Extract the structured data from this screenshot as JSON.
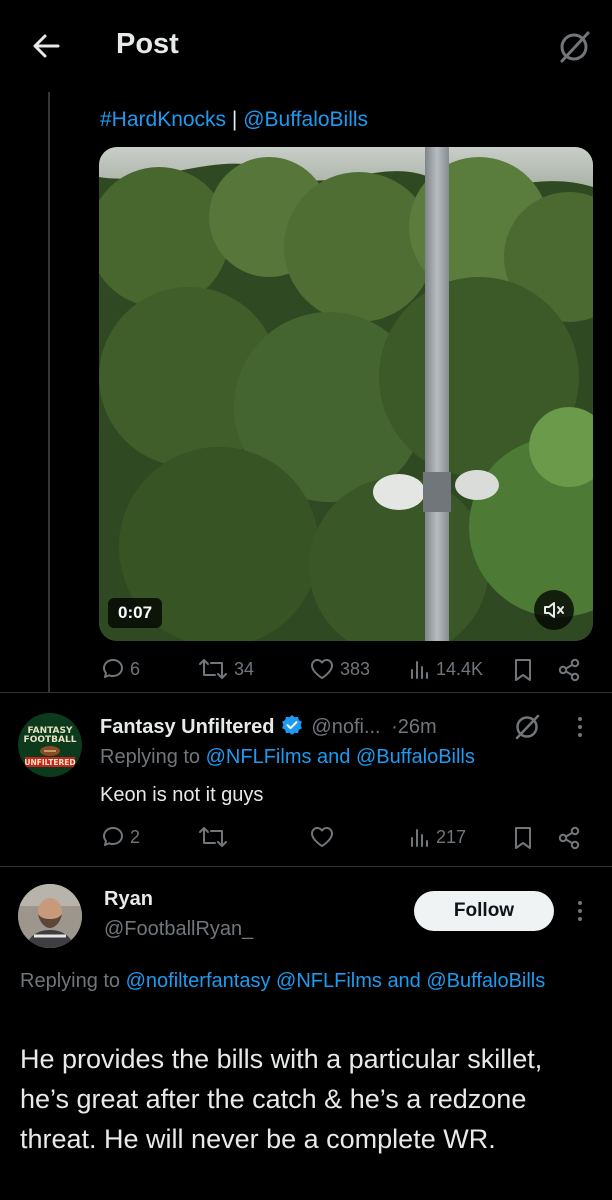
{
  "header": {
    "title": "Post"
  },
  "post": {
    "hashtag": "#HardKnocks",
    "separator": "|",
    "mention": "@BuffaloBills",
    "video_duration": "0:07",
    "stats": {
      "replies": "6",
      "reposts": "34",
      "likes": "383",
      "views": "14.4K"
    }
  },
  "reply1": {
    "avatar_lines": [
      "FANTASY",
      "FOOTBALL",
      "UNFILTERED"
    ],
    "name": "Fantasy Unfiltered",
    "handle": "@nofi...",
    "time": "·26m",
    "replying_prefix": "Replying to",
    "replying_1": "@NFLFilms",
    "replying_and": "and",
    "replying_2": "@BuffaloBills",
    "text": "Keon is not it guys",
    "stats": {
      "replies": "2",
      "reposts": "",
      "likes": "",
      "views": "217"
    }
  },
  "reply2": {
    "name": "Ryan",
    "handle": "@FootballRyan_",
    "follow_label": "Follow",
    "replying_prefix": "Replying to",
    "replying_1": "@nofilterfantasy",
    "replying_2": "@NFLFilms",
    "replying_and": "and",
    "replying_3": "@BuffaloBills",
    "text": "He provides the bills with a particular skillet, he’s great after the catch & he’s a redzone threat. He will never be a complete WR."
  },
  "colors": {
    "accent": "#1d9bf0",
    "muted": "#71767b",
    "background": "#000000",
    "verified": "#1d9bf0"
  }
}
